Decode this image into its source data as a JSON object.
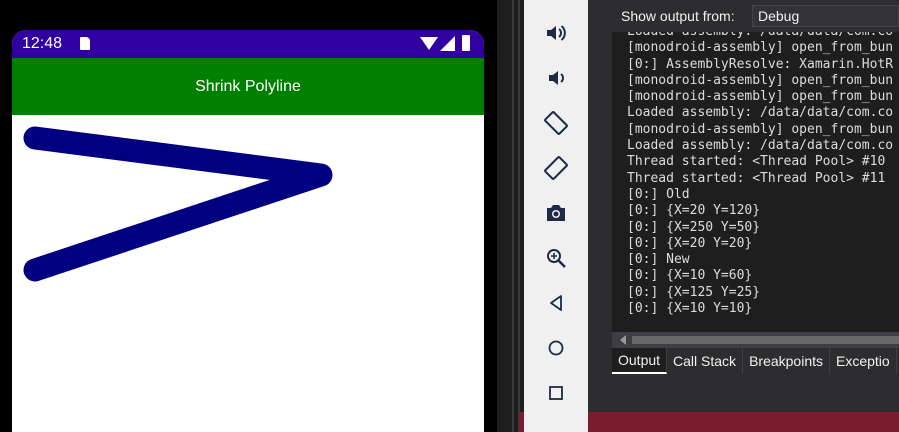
{
  "phone": {
    "status_time": "12:48",
    "app_title": "Shrink Polyline",
    "polyline_color": "#000080"
  },
  "emulator_toolbar": {
    "buttons": [
      "volume-up-icon",
      "volume-down-icon",
      "rotate-left-icon",
      "rotate-right-icon",
      "camera-icon",
      "zoom-icon",
      "back-icon",
      "home-icon",
      "overview-icon"
    ]
  },
  "output": {
    "show_label": "Show output from:",
    "source": "Debug",
    "lines": [
      "Loaded assembly: /data/data/com.co",
      "[monodroid-assembly] open_from_bun",
      "[0:] AssemblyResolve: Xamarin.HotR",
      "[monodroid-assembly] open_from_bun",
      "[monodroid-assembly] open_from_bun",
      "Loaded assembly: /data/data/com.co",
      "[monodroid-assembly] open_from_bun",
      "Loaded assembly: /data/data/com.co",
      "Thread started: <Thread Pool> #10",
      "Thread started: <Thread Pool> #11",
      "[0:] Old",
      "[0:] {X=20 Y=120}",
      "[0:] {X=250 Y=50}",
      "[0:] {X=20 Y=20}",
      "[0:] New",
      "[0:] {X=10 Y=60}",
      "[0:] {X=125 Y=25}",
      "[0:] {X=10 Y=10}"
    ],
    "tabs": [
      "Output",
      "Call Stack",
      "Breakpoints",
      "Exceptio"
    ]
  }
}
